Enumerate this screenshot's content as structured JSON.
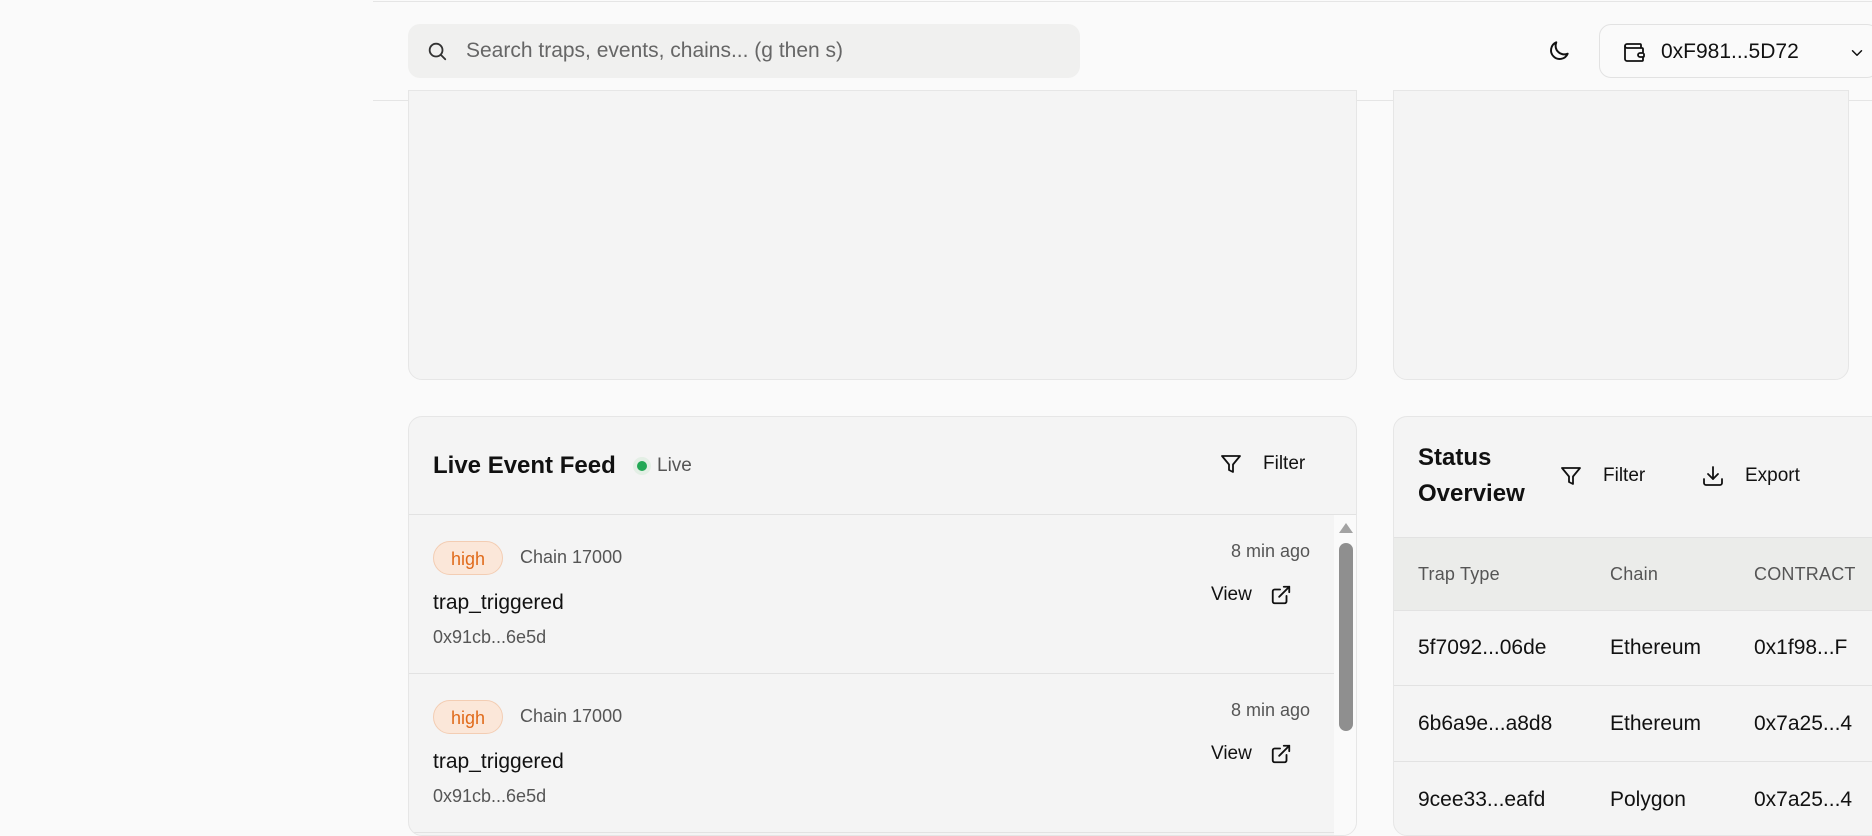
{
  "header": {
    "search_placeholder": "Search traps, events, chains... (g then s)",
    "wallet_address": "0xF981...5D72"
  },
  "feed": {
    "title": "Live Event Feed",
    "live_label": "Live",
    "filter_label": "Filter",
    "items": [
      {
        "severity": "high",
        "chain": "Chain 17000",
        "time": "8 min ago",
        "event": "trap_triggered",
        "hash": "0x91cb...6e5d",
        "view_label": "View"
      },
      {
        "severity": "high",
        "chain": "Chain 17000",
        "time": "8 min ago",
        "event": "trap_triggered",
        "hash": "0x91cb...6e5d",
        "view_label": "View"
      }
    ]
  },
  "status": {
    "title": "Status Overview",
    "filter_label": "Filter",
    "export_label": "Export",
    "columns": [
      "Trap Type",
      "Chain",
      "CONTRACT"
    ],
    "rows": [
      [
        "5f7092...06de",
        "Ethereum",
        "0x1f98...F"
      ],
      [
        "6b6a9e...a8d8",
        "Ethereum",
        "0x7a25...4"
      ],
      [
        "9cee33...eafd",
        "Polygon",
        "0x7a25...4"
      ]
    ]
  },
  "colors": {
    "live": "#22a855",
    "severity_high_text": "#e06a1a",
    "severity_high_bg": "#fbe7d9"
  }
}
